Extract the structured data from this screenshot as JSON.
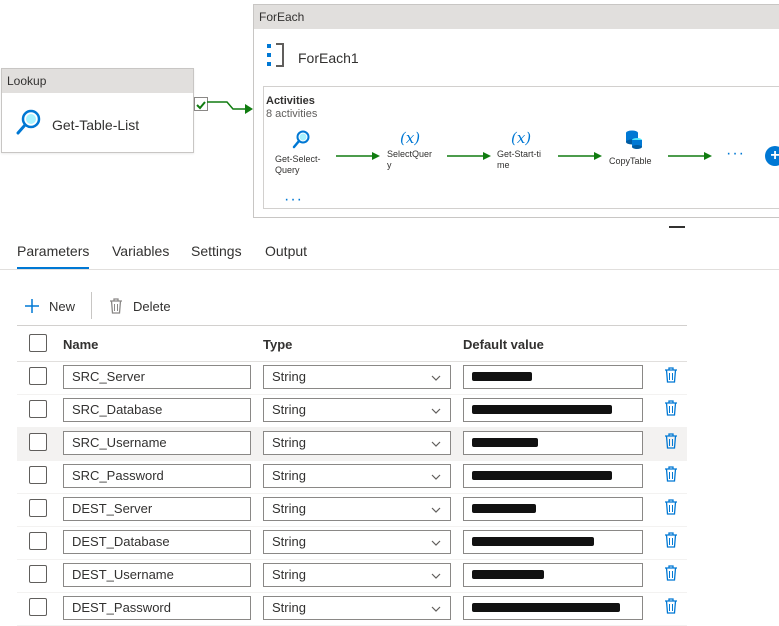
{
  "pipeline": {
    "lookup": {
      "header": "Lookup",
      "name": "Get-Table-List"
    },
    "foreach": {
      "header": "ForEach",
      "name": "ForEach1"
    },
    "activities": {
      "title": "Activities",
      "count": "8 activities",
      "items": [
        {
          "label_lines": [
            "Get-Select-",
            "Query"
          ],
          "icon": "lookup-icon"
        },
        {
          "label_lines": [
            "SelectQuer",
            "y"
          ],
          "icon": "variable-icon"
        },
        {
          "label_lines": [
            "Get-Start-ti",
            "me"
          ],
          "icon": "variable-icon"
        },
        {
          "label_lines": [
            "CopyTable"
          ],
          "icon": "copy-data-icon"
        }
      ],
      "more": "···"
    }
  },
  "tabs": [
    {
      "label": "Parameters",
      "active": true
    },
    {
      "label": "Variables",
      "active": false
    },
    {
      "label": "Settings",
      "active": false
    },
    {
      "label": "Output",
      "active": false
    }
  ],
  "toolbar": {
    "new_label": "New",
    "delete_label": "Delete"
  },
  "table": {
    "columns": [
      "Name",
      "Type",
      "Default value"
    ],
    "rows": [
      {
        "name": "SRC_Server",
        "type": "String",
        "default_redacted": true
      },
      {
        "name": "SRC_Database",
        "type": "String",
        "default_redacted": true
      },
      {
        "name": "SRC_Username",
        "type": "String",
        "default_redacted": true
      },
      {
        "name": "SRC_Password",
        "type": "String",
        "default_redacted": true
      },
      {
        "name": "DEST_Server",
        "type": "String",
        "default_redacted": true
      },
      {
        "name": "DEST_Database",
        "type": "String",
        "default_redacted": true
      },
      {
        "name": "DEST_Username",
        "type": "String",
        "default_redacted": true
      },
      {
        "name": "DEST_Password",
        "type": "String",
        "default_redacted": true
      }
    ]
  },
  "colors": {
    "accent": "#0078d4",
    "success": "#107c10",
    "header_bg": "#e1dfdd"
  }
}
